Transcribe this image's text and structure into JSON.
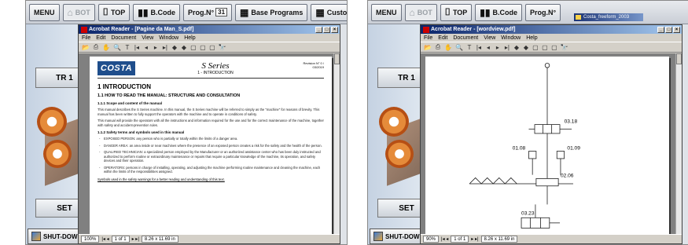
{
  "left": {
    "topbar": {
      "menu": "MENU",
      "bot": "BOT",
      "top": "TOP",
      "bcode": "B.Code",
      "prog_label": "Prog.N°",
      "prog_value": "31",
      "base_programs": "Base Programs",
      "custom_programs": "Custom Programs"
    },
    "sidebar": {
      "tr1": "TR 1",
      "set": "SET",
      "shutdown": "SHUT-DOWN"
    },
    "reader": {
      "title": "Acrobat Reader - [Pagine da Man_S.pdf]",
      "menu": [
        "File",
        "Edit",
        "Document",
        "View",
        "Window",
        "Help"
      ],
      "status": {
        "zoom": "100%",
        "page": "1 of 1",
        "size": "8.26 x 11.69 in"
      },
      "page": {
        "logo": "COSTA",
        "series": "S Series",
        "series_sub": "1 - INTRODUCTION",
        "revision": "Revision N° 0 / 03/2019",
        "h1": "1  INTRODUCTION",
        "h2": "1.1   HOW TO READ THE MANUAL: STRUCTURE AND CONSULTATION",
        "h3a": "1.1.1   Scope and content of the  manual",
        "p1": "This manual describes the S Series machine. In this manual, the S Series machine will be referred to simply as the \"machine\" for reasons of brevity. This manual has been written to fully support the operators with the machine and to operate in conditions of safety.",
        "p2": "This manual will provide the operators with all the instructions and information required for the use and for the correct maintenance of the machine, together with safety and accident-prevention rules.",
        "h3b": "1.1.2   Safety terms and symbols used in this manual",
        "b1": "EXPOSED PERSON: any person who is partially or totally within the limits of a danger area.",
        "b2": "DANGER AREA: an area inside or near machines where the presence of an exposed person creates a risk for the safety and the health of the person.",
        "b3": "QUALIFIED TECHNICIAN: a specialized person employed by the Manufacturer or an authorized assistance center who has been duly instructed and authorized to perform routine or extraordinary maintenance or repairs that require a particular knowledge of the machine, its operation, and safety devices and their operation.",
        "b4": "OPERATORS: persons in charge of installing, operating, and adjusting the machine performing routine maintenance and cleaning the machine, each within the limits of the responsibilities assigned.",
        "foot": "Symbols used in the safety warnings for a better reading and understanding of this  text."
      }
    }
  },
  "right": {
    "topbar": {
      "menu": "MENU",
      "bot": "BOT",
      "top": "TOP",
      "bcode": "B.Code",
      "prog_label": "Prog.N°"
    },
    "popup": "Costa_freeform_2003",
    "sidebar": {
      "tr1": "TR 1",
      "set": "SET",
      "shutdown": "SHUT-DOWN"
    },
    "reader": {
      "title": "Acrobat Reader - [wordview.pdf]",
      "menu": [
        "File",
        "Edit",
        "Document",
        "View",
        "Window",
        "Help"
      ],
      "status": {
        "zoom": "90%",
        "page": "1 of 1",
        "size": "8.26 x 11.69 in"
      },
      "diagram": {
        "v1": "03.18",
        "v2": "01.08",
        "v3": "01.09",
        "v4": "02.06",
        "v5": "03.23"
      }
    }
  }
}
